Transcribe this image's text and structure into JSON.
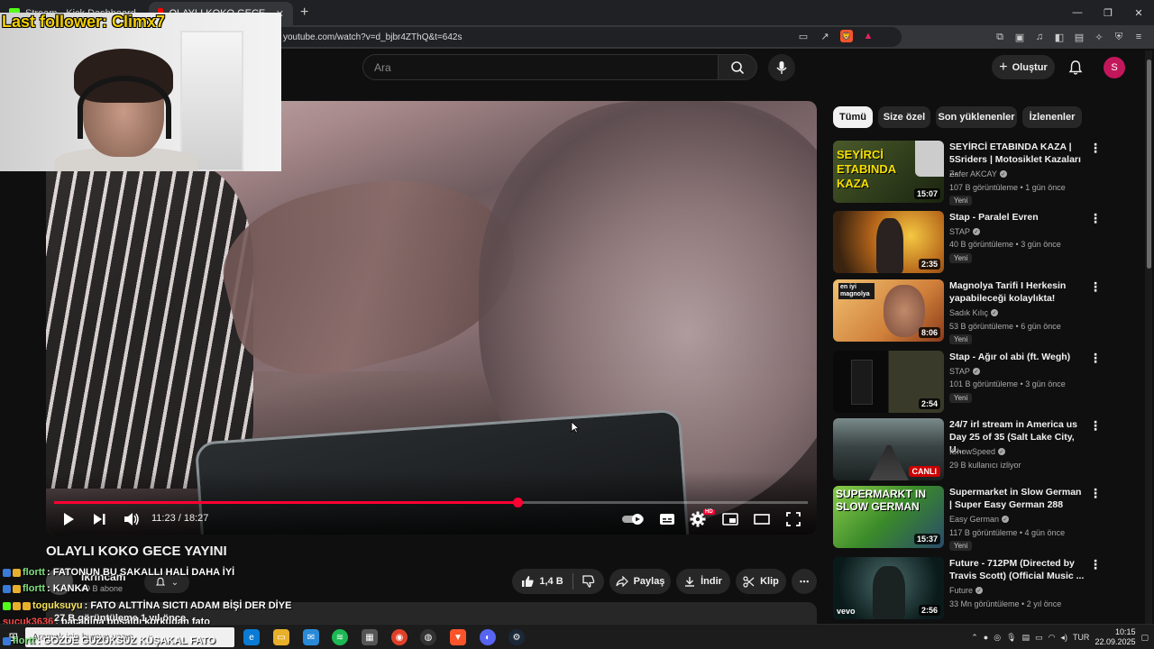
{
  "browser": {
    "tabs": [
      {
        "title": "Stream - Kick Dashboard",
        "active": false
      },
      {
        "title": "OLAYLI KOKO GECE YAYINI - YouTube",
        "active": true
      }
    ],
    "new_tab": "+",
    "url": "youtube.com/watch?v=d_bjbr4ZThQ&t=642s"
  },
  "yt": {
    "search_placeholder": "Ara",
    "create_label": "Oluştur",
    "avatar_letter": "S"
  },
  "player": {
    "time": "11:23 / 18:27",
    "progress": 0.615,
    "hd": "HD"
  },
  "video": {
    "title": "OLAYLI KOKO GECE YAYINI",
    "channel": "ikrincam",
    "subs": "49 B abone",
    "likes": "1,4 B",
    "share": "Paylaş",
    "download": "İndir",
    "clip": "Klip",
    "more": "⋯",
    "description_views": "27 B görüntüleme  1 yıl önce"
  },
  "chips": [
    "Tümü",
    "Size özel",
    "Son yüklenenler",
    "İzlenenler"
  ],
  "recommendations": [
    {
      "title": "SEYİRCİ ETABINDA KAZA | 5Sriders | Motosiklet Kazaları ...",
      "channel": "Zafer AKCAY",
      "meta": "107 B görüntüleme • 1 gün önce",
      "badge": "Yeni",
      "duration": "15:07",
      "thumb_text": "SEYİRCİ ETABINDA KAZA",
      "colors": [
        "#3a4a2a",
        "#1a2410"
      ]
    },
    {
      "title": "Stap - Paralel Evren",
      "channel": "STAP",
      "meta": "40 B görüntüleme • 3 gün önce",
      "badge": "Yeni",
      "duration": "2:35",
      "thumb_text": "",
      "colors": [
        "#c4a42a",
        "#3a2a10"
      ]
    },
    {
      "title": "Magnolya Tarifi I Herkesin yapabileceği kolaylıkta!",
      "channel": "Sadık Kılıç",
      "meta": "53 B görüntüleme • 6 gün önce",
      "badge": "Yeni",
      "duration": "8:06",
      "thumb_text": "en iyi magnolya",
      "colors": [
        "#e2a24a",
        "#b2602a"
      ]
    },
    {
      "title": "Stap - Ağır ol abi (ft. Wegh)",
      "channel": "STAP",
      "meta": "101 B görüntüleme • 3 gün önce",
      "badge": "Yeni",
      "duration": "2:54",
      "thumb_text": "",
      "colors": [
        "#2a2a2a",
        "#0a0a0a"
      ]
    },
    {
      "title": "24/7 irl stream in America us Day 25 of 35 (Salt Lake City, U...",
      "channel": "IShowSpeed",
      "meta": "29 B kullanıcı izliyor",
      "badge": "",
      "duration": "CANLI",
      "thumb_text": "",
      "colors": [
        "#5a6a6a",
        "#1a2222"
      ]
    },
    {
      "title": "Supermarket in Slow German | Super Easy German 288",
      "channel": "Easy German",
      "meta": "117 B görüntüleme • 4 gün önce",
      "badge": "Yeni",
      "duration": "15:37",
      "thumb_text": "SUPERMARKT IN SLOW GERMAN",
      "colors": [
        "#6aaa3a",
        "#2a5a2a"
      ]
    },
    {
      "title": "Future - 712PM (Directed by Travis Scott) (Official Music ...",
      "channel": "Future",
      "meta": "33 Mn görüntüleme • 2 yıl önce",
      "badge": "",
      "duration": "2:56",
      "thumb_text": "vevo",
      "colors": [
        "#2a4a4a",
        "#0a1a1a"
      ]
    }
  ],
  "overlay": {
    "follower_text": "Last follower: Climx7",
    "chat": [
      {
        "user": "flortt",
        "message": ": FATONUN BU SAKALLI HALİ DAHA İYİ",
        "user_color": "#7ee07e"
      },
      {
        "user": "flortt",
        "message": ": KANKA",
        "user_color": "#7ee07e"
      },
      {
        "user": "toguksuyu",
        "message": ": FATO ALTTİNA SICTI ADAM BİŞİ DER DİYE",
        "user_color": "#f5e25a"
      },
      {
        "user": "sucuk3636",
        "message": ": bacağına boşaldı korkudan fato",
        "user_color": "#ff4a4a"
      },
      {
        "user": "flortt",
        "message": ": GÖZDE GÜZÜKSÜZ KÜŞAKAL FATO",
        "user_color": "#7ee07e"
      }
    ]
  },
  "taskbar": {
    "search_text": "Aramak için buraya yazın",
    "lang": "TUR",
    "time": "10:15",
    "date": "22.09.2025"
  }
}
